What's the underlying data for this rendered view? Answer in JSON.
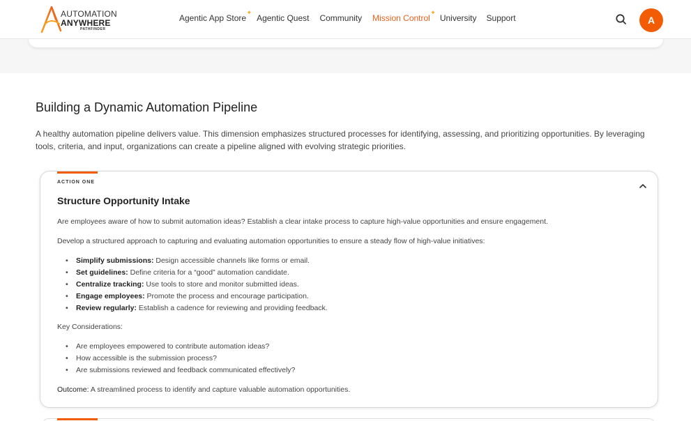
{
  "brand": {
    "line1": "AUTOMATION",
    "line2": "ANYWHERE",
    "line3": "PATHFINDER",
    "accent_color": "#f25c05"
  },
  "nav": {
    "items": [
      {
        "label": "Agentic App Store",
        "sparkle": true
      },
      {
        "label": "Agentic Quest",
        "sparkle": false
      },
      {
        "label": "Community",
        "sparkle": false
      },
      {
        "label": "Mission Control",
        "sparkle": true,
        "active": true
      },
      {
        "label": "University",
        "sparkle": false
      },
      {
        "label": "Support",
        "sparkle": false
      }
    ],
    "search_icon": "search-icon",
    "avatar_initial": "A"
  },
  "section": {
    "title": "Building a Dynamic Automation Pipeline",
    "description": "A healthy automation pipeline delivers value. This dimension emphasizes structured processes for identifying, assessing, and prioritizing opportunities. By leveraging tools, criteria, and input, organizations can create a pipeline aligned with evolving strategic priorities."
  },
  "card": {
    "eyebrow": "ACTION ONE",
    "title": "Structure Opportunity Intake",
    "intro": "Are employees aware of how to submit automation ideas? Establish a clear intake process to capture high-value opportunities and ensure engagement.",
    "approach": "Develop a structured approach to capturing and evaluating automation opportunities to ensure a steady flow of high-value initiatives:",
    "steps": [
      {
        "term": "Simplify submissions:",
        "text": " Design accessible channels like forms or email."
      },
      {
        "term": "Set guidelines:",
        "text": " Define criteria for a “good” automation candidate."
      },
      {
        "term": "Centralize tracking:",
        "text": " Use tools to store and monitor submitted ideas."
      },
      {
        "term": "Engage employees:",
        "text": " Promote the process and encourage participation."
      },
      {
        "term": "Review regularly:",
        "text": " Establish a cadence for reviewing and providing feedback."
      }
    ],
    "considerations_label": "Key Considerations:",
    "considerations": [
      "Are employees empowered to contribute automation ideas?",
      "How accessible is the submission process?",
      "Are submissions reviewed and feedback communicated effectively?"
    ],
    "outcome_label": "Outcome:",
    "outcome_text": " A streamlined process to identify and capture valuable automation opportunities.",
    "toggle_icon": "chevron-up-icon"
  }
}
